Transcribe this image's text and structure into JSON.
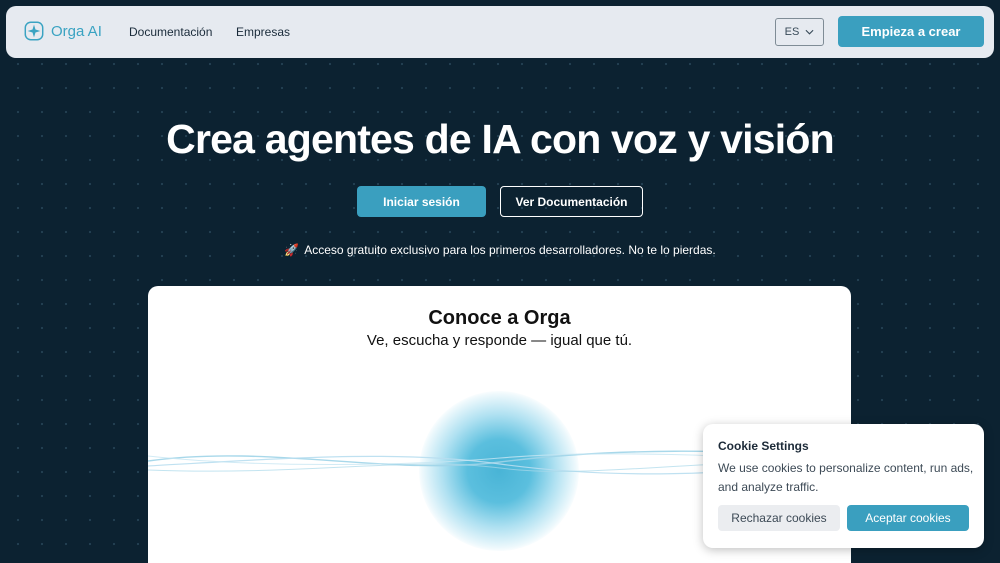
{
  "header": {
    "logo_text": "Orga AI",
    "nav": [
      {
        "label": "Documentación"
      },
      {
        "label": "Empresas"
      }
    ],
    "language": "ES",
    "cta_label": "Empieza a crear"
  },
  "hero": {
    "title": "Crea agentes de IA con voz y visión",
    "login_label": "Iniciar sesión",
    "docs_label": "Ver Documentación",
    "promo_icon": "🚀",
    "promo_text": "Acceso gratuito exclusivo para los primeros desarrolladores. No te lo pierdas."
  },
  "card": {
    "title": "Conoce a Orga",
    "subtitle": "Ve, escucha y responde — igual que tú."
  },
  "cookie": {
    "title": "Cookie Settings",
    "text": "We use cookies to personalize content, run ads, and analyze traffic.",
    "reject_label": "Rechazar cookies",
    "accept_label": "Aceptar cookies"
  },
  "colors": {
    "background": "#0c2231",
    "accent": "#3a9fbf",
    "navbar": "#e6eaf0"
  },
  "icons": {
    "logo": "orga-logo-icon",
    "language_chevron": "chevron-down-icon",
    "promo": "rocket-icon"
  }
}
